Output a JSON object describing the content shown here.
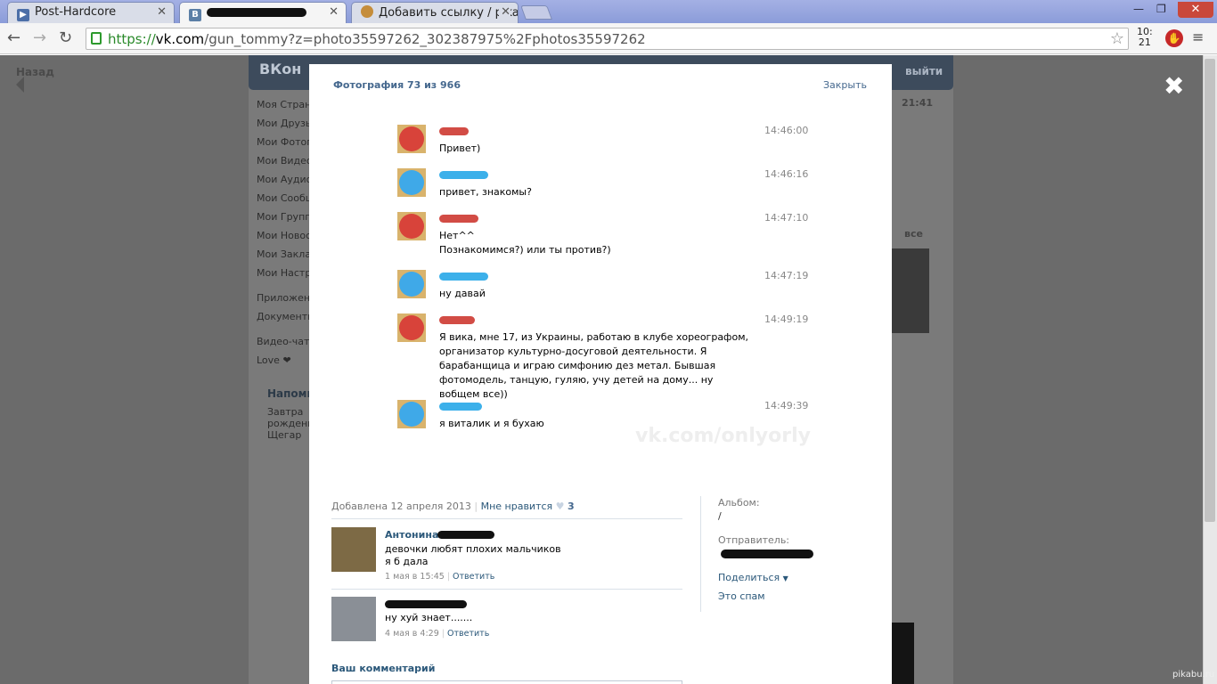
{
  "browser": {
    "tabs": [
      {
        "label": "Post-Hardcore",
        "icon": "play-icon",
        "color": "#4c6fa8"
      },
      {
        "label": "",
        "icon": "vk-icon",
        "color": "#5b7fa6"
      },
      {
        "label": "Добавить ссылку / pikabu",
        "icon": "pikabu-icon",
        "color": "#c58d3b"
      }
    ],
    "url_scheme": "https://",
    "url_host": "vk.com",
    "url_path": "/gun_tommy?z=photo35597262_302387975%2Fphotos35597262",
    "clock": "10:\n21"
  },
  "vk": {
    "logo": "ВКон",
    "logout": "выйти",
    "back": "Назад",
    "sidebar": [
      "Моя Страни",
      "Мои Друзья",
      "Мои Фотогр",
      "Мои Видеоз",
      "Мои Аудиоз",
      "Мои Сообщ",
      "Мои Группы",
      "Мои Новост",
      "Мои Заклад",
      "Мои Настро",
      "Приложени",
      "Документы",
      "Видео-чат",
      "Love ❤"
    ],
    "reminder_title": "Напоми",
    "reminder_text": "Завтра рождени Щегар",
    "bg_time": "21:41",
    "bg_all": "все"
  },
  "photo_box": {
    "title": "Фотография 73 из 966",
    "close": "Закрыть",
    "messages": [
      {
        "side": "red",
        "time": "14:46:00",
        "text": "Привет)"
      },
      {
        "side": "blue",
        "time": "14:46:16",
        "text": "привет, знакомы?"
      },
      {
        "side": "red",
        "time": "14:47:10",
        "text": "Нет^^\nПознакомимся?) или ты против?)"
      },
      {
        "side": "blue",
        "time": "14:47:19",
        "text": "ну давай"
      },
      {
        "side": "red",
        "time": "14:49:19",
        "text": "Я вика, мне 17, из Украины, работаю в клубе хореографом, организатор культурно-досуговой деятельности. Я барабанщица и играю симфонию дез метал. Бывшая фотомодель, танцую, гуляю, учу детей на дому... ну вобщем все))"
      },
      {
        "side": "blue",
        "time": "14:49:39",
        "text": "я виталик и я бухаю"
      }
    ],
    "watermark": "vk.com/onlyorly",
    "added": "Добавлена 12 апреля 2013",
    "like": "Мне нравится",
    "like_count": "3",
    "comments": [
      {
        "name": "Антонина",
        "text": "девочки любят плохих мальчиков\nя б дала",
        "date": "1 мая в 15:45",
        "reply": "Ответить"
      },
      {
        "name": "",
        "text": "ну хуй знает.......",
        "date": "4 мая в 4:29",
        "reply": "Ответить"
      }
    ],
    "album_label": "Альбом:",
    "album_value": "/",
    "sender_label": "Отправитель:",
    "share": "Поделиться",
    "spam": "Это спам",
    "your_comment": "Ваш комментарий"
  },
  "footer_watermark": "pikabu.ru"
}
